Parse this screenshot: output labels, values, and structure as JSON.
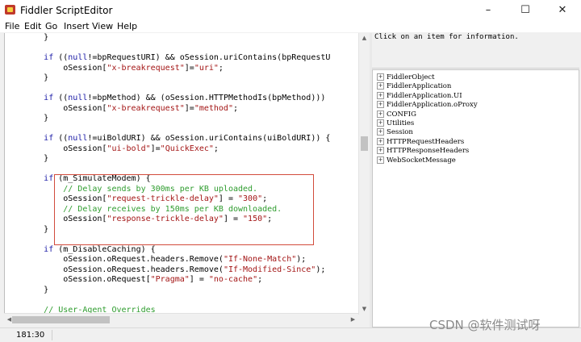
{
  "window": {
    "title": "Fiddler ScriptEditor",
    "controls": {
      "minimize": "–",
      "maximize": "☐",
      "close": "✕"
    }
  },
  "menu": [
    "File",
    "Edit",
    "Go",
    "Insert",
    "View",
    "Help"
  ],
  "code_lines": [
    [
      {
        "t": "        }",
        "c": ""
      }
    ],
    [
      {
        "t": "",
        "c": ""
      }
    ],
    [
      {
        "t": "        ",
        "c": ""
      },
      {
        "t": "if",
        "c": "kw"
      },
      {
        "t": " ((",
        "c": ""
      },
      {
        "t": "null",
        "c": "kw"
      },
      {
        "t": "!=bpRequestURI) && oSession.uriContains(bpRequestU",
        "c": ""
      }
    ],
    [
      {
        "t": "            oSession[",
        "c": ""
      },
      {
        "t": "\"x-breakrequest\"",
        "c": "str"
      },
      {
        "t": "]=",
        "c": ""
      },
      {
        "t": "\"uri\"",
        "c": "str"
      },
      {
        "t": ";",
        "c": ""
      }
    ],
    [
      {
        "t": "        }",
        "c": ""
      }
    ],
    [
      {
        "t": "",
        "c": ""
      }
    ],
    [
      {
        "t": "        ",
        "c": ""
      },
      {
        "t": "if",
        "c": "kw"
      },
      {
        "t": " ((",
        "c": ""
      },
      {
        "t": "null",
        "c": "kw"
      },
      {
        "t": "!=bpMethod) && (oSession.HTTPMethodIs(bpMethod)))",
        "c": ""
      }
    ],
    [
      {
        "t": "            oSession[",
        "c": ""
      },
      {
        "t": "\"x-breakrequest\"",
        "c": "str"
      },
      {
        "t": "]=",
        "c": ""
      },
      {
        "t": "\"method\"",
        "c": "str"
      },
      {
        "t": ";",
        "c": ""
      }
    ],
    [
      {
        "t": "        }",
        "c": ""
      }
    ],
    [
      {
        "t": "",
        "c": ""
      }
    ],
    [
      {
        "t": "        ",
        "c": ""
      },
      {
        "t": "if",
        "c": "kw"
      },
      {
        "t": " ((",
        "c": ""
      },
      {
        "t": "null",
        "c": "kw"
      },
      {
        "t": "!=uiBoldURI) && oSession.uriContains(uiBoldURI)) {",
        "c": ""
      }
    ],
    [
      {
        "t": "            oSession[",
        "c": ""
      },
      {
        "t": "\"ui-bold\"",
        "c": "str"
      },
      {
        "t": "]=",
        "c": ""
      },
      {
        "t": "\"QuickExec\"",
        "c": "str"
      },
      {
        "t": ";",
        "c": ""
      }
    ],
    [
      {
        "t": "        }",
        "c": ""
      }
    ],
    [
      {
        "t": "",
        "c": ""
      }
    ],
    [
      {
        "t": "        ",
        "c": ""
      },
      {
        "t": "if",
        "c": "kw"
      },
      {
        "t": " (m_SimulateModem) {",
        "c": ""
      }
    ],
    [
      {
        "t": "            ",
        "c": ""
      },
      {
        "t": "// Delay sends by 300ms per KB uploaded.",
        "c": "cm"
      }
    ],
    [
      {
        "t": "            oSession[",
        "c": ""
      },
      {
        "t": "\"request-trickle-delay\"",
        "c": "str"
      },
      {
        "t": "] = ",
        "c": ""
      },
      {
        "t": "\"300\"",
        "c": "str"
      },
      {
        "t": ";",
        "c": ""
      }
    ],
    [
      {
        "t": "            ",
        "c": ""
      },
      {
        "t": "// Delay receives by 150ms per KB downloaded.",
        "c": "cm"
      }
    ],
    [
      {
        "t": "            oSession[",
        "c": ""
      },
      {
        "t": "\"response-trickle-delay\"",
        "c": "str"
      },
      {
        "t": "] = ",
        "c": ""
      },
      {
        "t": "\"150\"",
        "c": "str"
      },
      {
        "t": ";",
        "c": ""
      }
    ],
    [
      {
        "t": "        }",
        "c": ""
      }
    ],
    [
      {
        "t": "",
        "c": ""
      }
    ],
    [
      {
        "t": "        ",
        "c": ""
      },
      {
        "t": "if",
        "c": "kw"
      },
      {
        "t": " (m_DisableCaching) {",
        "c": ""
      }
    ],
    [
      {
        "t": "            oSession.oRequest.headers.Remove(",
        "c": ""
      },
      {
        "t": "\"If-None-Match\"",
        "c": "str"
      },
      {
        "t": ");",
        "c": ""
      }
    ],
    [
      {
        "t": "            oSession.oRequest.headers.Remove(",
        "c": ""
      },
      {
        "t": "\"If-Modified-Since\"",
        "c": "str"
      },
      {
        "t": ");",
        "c": ""
      }
    ],
    [
      {
        "t": "            oSession.oRequest[",
        "c": ""
      },
      {
        "t": "\"Pragma\"",
        "c": "str"
      },
      {
        "t": "] = ",
        "c": ""
      },
      {
        "t": "\"no-cache\"",
        "c": "str"
      },
      {
        "t": ";",
        "c": ""
      }
    ],
    [
      {
        "t": "        }",
        "c": ""
      }
    ],
    [
      {
        "t": "",
        "c": ""
      }
    ],
    [
      {
        "t": "        ",
        "c": ""
      },
      {
        "t": "// User-Agent Overrides",
        "c": "cm"
      }
    ]
  ],
  "info_panel": {
    "text": "Click on an item for information."
  },
  "tree_items": [
    "FiddlerObject",
    "FiddlerApplication",
    "FiddlerApplication.UI",
    "FiddlerApplication.oProxy",
    "CONFIG",
    "Utilities",
    "Session",
    "HTTPRequestHeaders",
    "HTTPResponseHeaders",
    "WebSocketMessage"
  ],
  "status": {
    "position": "181:30"
  },
  "watermark": "CSDN @软件测试呀",
  "colors": {
    "keyword": "#1a1aa6",
    "string": "#a31515",
    "comment": "#2e9c2e",
    "highlight_border": "#d24b3c"
  }
}
